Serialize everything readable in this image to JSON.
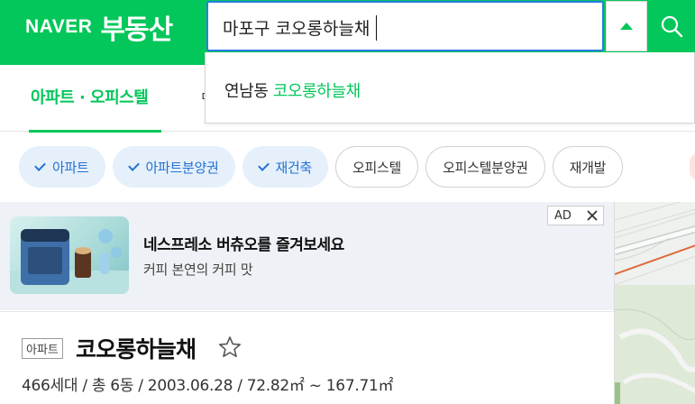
{
  "header": {
    "brand": "NAVER",
    "service": "부동산",
    "search": {
      "value": "마포구 코오롱하늘채"
    },
    "colors": {
      "brand_green": "#03c75a",
      "search_border": "#2a7de1"
    },
    "icons": {
      "toggle": "caret-up-icon",
      "search": "search-icon"
    }
  },
  "autocomplete": {
    "items": [
      {
        "region": "연남동",
        "match": "코오롱하늘채"
      }
    ]
  },
  "tabs": {
    "active": "아파트 · 오피스텔",
    "next_peek": "ㄷ"
  },
  "filters": [
    {
      "label": "아파트",
      "selected": true
    },
    {
      "label": "아파트분양권",
      "selected": true
    },
    {
      "label": "재건축",
      "selected": true
    },
    {
      "label": "오피스텔",
      "selected": false
    },
    {
      "label": "오피스텔분양권",
      "selected": false
    },
    {
      "label": "재개발",
      "selected": false
    }
  ],
  "ad": {
    "title": "네스프레소 버츄오를 즐겨보세요",
    "subtitle": "커피 본연의 커피 맛",
    "badge": "AD",
    "close_icon": "close-icon"
  },
  "property": {
    "type_badge": "아파트",
    "name": "코오롱하늘채",
    "meta": "466세대 / 총 6동 / 2003.06.28 / 72.82㎡ ~ 167.71㎡",
    "favorite_icon": "star-outline-icon"
  }
}
